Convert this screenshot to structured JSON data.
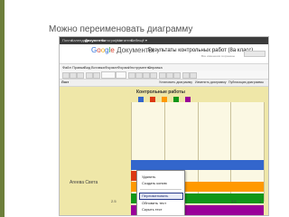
{
  "slide": {
    "title": "Можно переименовать диаграмму"
  },
  "gbar": {
    "items": [
      "Почта",
      "Календарь",
      "Документы",
      "Фотографии",
      "Читатель",
      "Веб",
      "ещё ▾"
    ],
    "active_index": 2
  },
  "header": {
    "logo_parts": [
      "G",
      "o",
      "o",
      "g",
      "l",
      "e"
    ],
    "logo_docs": "Документы",
    "doc_title": "Результаты контрольных работ (8а класс)",
    "saved_note": "Все изменения сохранены"
  },
  "menubar": {
    "items": [
      "Файл",
      "Правка",
      "Вид",
      "Вставка",
      "Формат",
      "Форма",
      "Инструменты",
      "Справка"
    ]
  },
  "toolbar": {
    "buttons": 14
  },
  "chartbar": {
    "sheet": "Лист",
    "items": [
      "Установить диаграмму",
      "Изменить диаграмму",
      "Публикация диаграммы"
    ]
  },
  "chart_data": {
    "type": "bar",
    "title": "Контрольные работы",
    "categories": [
      "Агеева Света"
    ],
    "series": [
      {
        "values": [
          5
        ],
        "color": "#3366cc"
      },
      {
        "values": [
          1.4
        ],
        "color": "#dc3912"
      },
      {
        "values": [
          5
        ],
        "color": "#ff9900"
      },
      {
        "values": [
          5
        ],
        "color": "#109618"
      },
      {
        "values": [
          5
        ],
        "color": "#990099"
      }
    ],
    "xlim": [
      1,
      5
    ],
    "xticks": [
      "2.5",
      "3.5",
      "4"
    ],
    "legend_colors": [
      "#3366cc",
      "#dc3912",
      "#ff9900",
      "#109618",
      "#990099"
    ]
  },
  "context_menu": {
    "items": [
      "Удалить",
      "Создать копию",
      "Переименовать",
      "Обновить тест",
      "Скрыть тест"
    ],
    "highlighted_index": 2
  },
  "colors": {
    "accent": "#6d7f3b"
  }
}
